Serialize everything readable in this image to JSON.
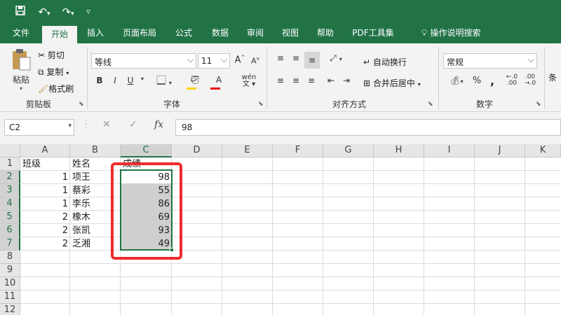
{
  "quick_access": {
    "save_icon": "save-icon",
    "undo_icon": "undo-icon",
    "redo_icon": "redo-icon",
    "customize_icon": "customize-qat-icon"
  },
  "tabs": [
    {
      "label": "文件"
    },
    {
      "label": "开始",
      "active": true
    },
    {
      "label": "插入"
    },
    {
      "label": "页面布局"
    },
    {
      "label": "公式"
    },
    {
      "label": "数据"
    },
    {
      "label": "审阅"
    },
    {
      "label": "视图"
    },
    {
      "label": "帮助"
    },
    {
      "label": "PDF工具集"
    }
  ],
  "tell_me": {
    "label": "操作说明搜索"
  },
  "ribbon": {
    "clipboard": {
      "paste": "粘贴",
      "cut": "剪切",
      "copy": "复制",
      "format_painter": "格式刷",
      "group": "剪贴板"
    },
    "font": {
      "font_name": "等线",
      "font_size": "11",
      "bold": "B",
      "italic": "I",
      "underline": "U",
      "grow": "A",
      "shrink": "A",
      "group": "字体"
    },
    "alignment": {
      "wrap_text": "自动换行",
      "merge_center": "合并后居中",
      "group": "对齐方式"
    },
    "number": {
      "format": "常规",
      "percent": "%",
      "comma": ",",
      "increase_decimal": ".0\n.00",
      "group": "数字"
    },
    "cond": {
      "label": "条"
    }
  },
  "formula_bar": {
    "name_box": "C2",
    "formula": "98",
    "fx": "fx"
  },
  "columns": [
    "A",
    "B",
    "C",
    "D",
    "E",
    "F",
    "G",
    "H",
    "I",
    "J",
    "K"
  ],
  "rows": [
    "1",
    "2",
    "3",
    "4",
    "5",
    "6",
    "7",
    "8",
    "9",
    "10",
    "11",
    "12"
  ],
  "sheet": {
    "header": {
      "a": "班级",
      "b": "姓名",
      "c": "成绩"
    },
    "data": [
      {
        "a": "1",
        "b": "项王",
        "c": "98"
      },
      {
        "a": "1",
        "b": "蔡彩",
        "c": "55"
      },
      {
        "a": "1",
        "b": "李乐",
        "c": "86"
      },
      {
        "a": "2",
        "b": "橡木",
        "c": "69"
      },
      {
        "a": "2",
        "b": "张凯",
        "c": "93"
      },
      {
        "a": "2",
        "b": "乏湘",
        "c": "49"
      }
    ]
  },
  "colors": {
    "accent": "#217346",
    "highlight": "#f02b2b",
    "selection_fill": "#cfcfcf"
  }
}
